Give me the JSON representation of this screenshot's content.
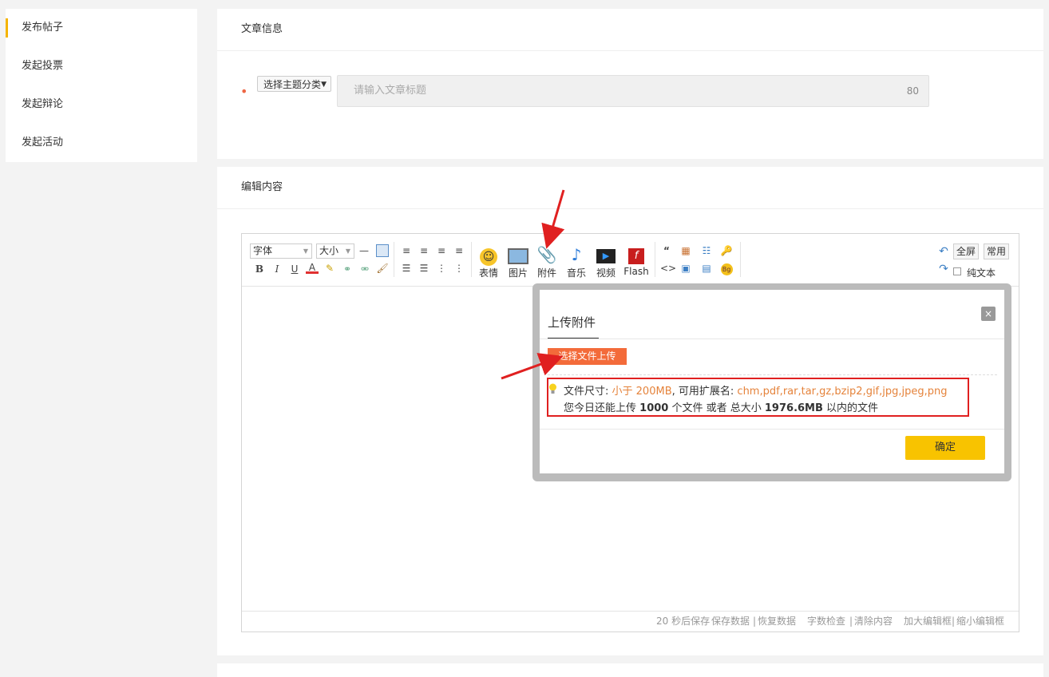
{
  "sidebar": {
    "items": [
      {
        "label": "发布帖子",
        "active": true
      },
      {
        "label": "发起投票",
        "active": false
      },
      {
        "label": "发起辩论",
        "active": false
      },
      {
        "label": "发起活动",
        "active": false
      }
    ],
    "accent_color": "#f5b400"
  },
  "article_info": {
    "section_title": "文章信息",
    "required_mark": "•",
    "topic_select": "选择主题分类",
    "title_placeholder": "请输入文章标题",
    "title_max": "80"
  },
  "editor_section": {
    "section_title": "编辑内容"
  },
  "toolbar": {
    "font_family": "字体",
    "font_size": "大小",
    "big_buttons": [
      {
        "label": "表情",
        "icon": "smiley-icon"
      },
      {
        "label": "图片",
        "icon": "image-icon"
      },
      {
        "label": "附件",
        "icon": "paperclip-icon"
      },
      {
        "label": "音乐",
        "icon": "music-note-icon"
      },
      {
        "label": "视频",
        "icon": "clapperboard-icon"
      },
      {
        "label": "Flash",
        "icon": "flash-icon"
      }
    ],
    "fullscreen": "全屏",
    "common": "常用",
    "plain_text": "纯文本"
  },
  "statusbar": {
    "autosave": "20 秒后保存",
    "save": "保存数据",
    "sep": "|",
    "restore": "恢复数据",
    "word_check": "字数检查",
    "clear": "清除内容",
    "enlarge": "加大编辑框",
    "shrink": "缩小编辑框"
  },
  "dialog": {
    "title": "上传附件",
    "close": "×",
    "upload_button": "选择文件上传",
    "size_label": "文件尺寸:",
    "size_value": "小于 200MB",
    "ext_label": ", 可用扩展名:",
    "ext_value": "chm,pdf,rar,tar,gz,bzip2,gif,jpg,jpeg,png",
    "quota_prefix": "您今日还能上传",
    "quota_count": "1000",
    "quota_mid": "个文件 或者 总大小",
    "quota_size": "1976.6MB",
    "quota_suffix": "以内的文件",
    "ok": "确定"
  },
  "colors": {
    "highlight": "#e5833b",
    "upload_btn": "#f36b3a",
    "ok_btn": "#f8c300",
    "annotation": "#e02020"
  }
}
